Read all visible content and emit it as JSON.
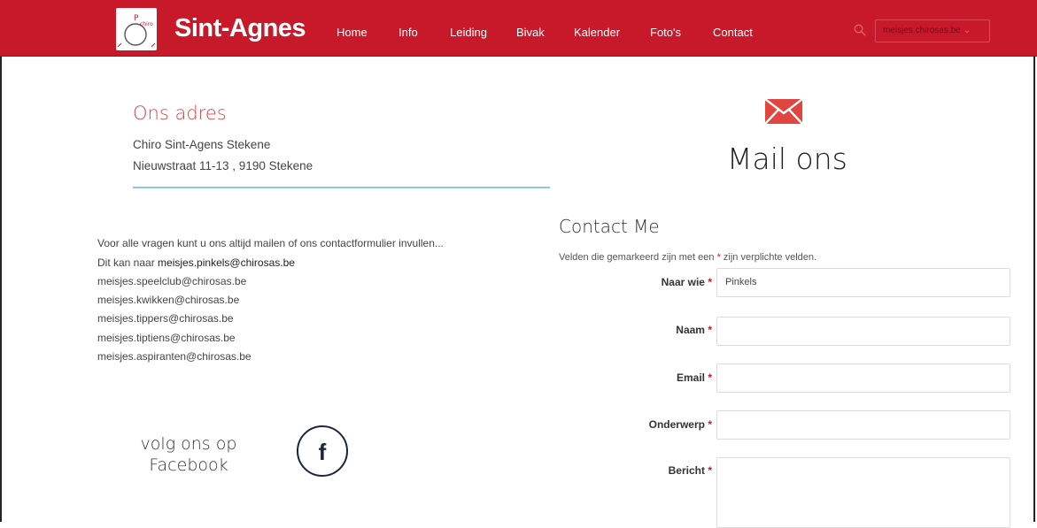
{
  "header": {
    "brand": "Sint-Agnes",
    "nav": [
      "Home",
      "Info",
      "Leiding",
      "Bivak",
      "Kalender",
      "Foto's",
      "Contact"
    ],
    "domain_select": "meisjes.chirosas.be",
    "accent_color": "#c8192b"
  },
  "address": {
    "title": "Ons adres",
    "line1": "Chiro Sint-Agens Stekene",
    "line2": "Nieuwstraat 11-13 , 9190 Stekene"
  },
  "mail": {
    "title": "Mail ons",
    "icon": "envelope-icon"
  },
  "info": {
    "intro": "Voor alle vragen kunt u ons altijd mailen of ons contactformulier invullen...",
    "prefix": "Dit kan naar ",
    "emails": [
      "meisjes.pinkels@chirosas.be",
      "meisjes.speelclub@chirosas.be",
      "meisjes.kwikken@chirosas.be",
      "meisjes.tippers@chirosas.be",
      "meisjes.tiptiens@chirosas.be",
      "meisjes.aspiranten@chirosas.be"
    ]
  },
  "facebook": {
    "line1": "volg ons op",
    "line2": "Facebook",
    "icon_letter": "f"
  },
  "contact": {
    "title": "Contact Me",
    "note_before": "Velden die gemarkeerd zijn met een ",
    "star": "*",
    "note_after": " zijn verplichte velden.",
    "fields": {
      "naar_wie": {
        "label": "Naar wie",
        "value": "Pinkels"
      },
      "naam": {
        "label": "Naam",
        "value": ""
      },
      "email": {
        "label": "Email",
        "value": ""
      },
      "onderwerp": {
        "label": "Onderwerp",
        "value": ""
      },
      "bericht": {
        "label": "Bericht",
        "value": ""
      }
    }
  }
}
